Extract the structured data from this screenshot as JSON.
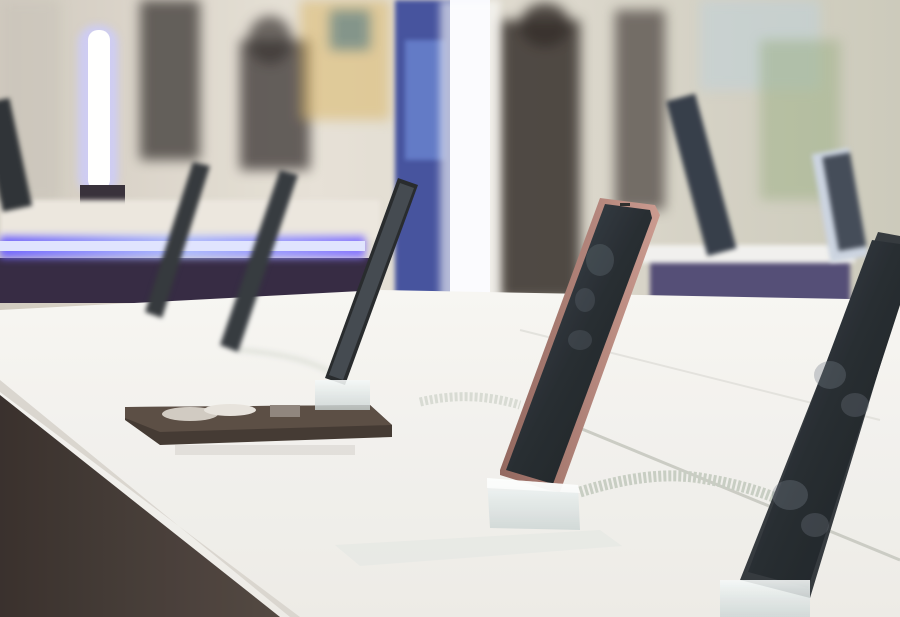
{
  "photo": {
    "subject": "",
    "palette": {
      "backdrop": "#ddd6cc",
      "table_top": "#f3f1ee",
      "table_side": "#3a302c",
      "led_strip": "#7b6cff",
      "lightbox": "#eef4ff",
      "screen": "#1d2228",
      "phone_rose": "#b07a6e",
      "cable": "#c9cdc4"
    }
  }
}
